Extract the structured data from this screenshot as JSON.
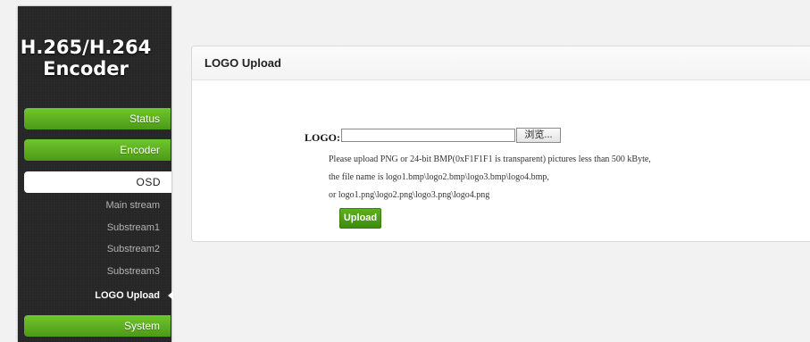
{
  "brand": {
    "line1": "H.265/H.264",
    "line2": "Encoder"
  },
  "sidebar": {
    "status_label": "Status",
    "encoder_label": "Encoder",
    "osd_label": "OSD",
    "sub_items": [
      {
        "label": "Main stream",
        "active": false
      },
      {
        "label": "Substream1",
        "active": false
      },
      {
        "label": "Substream2",
        "active": false
      },
      {
        "label": "Substream3",
        "active": false
      },
      {
        "label": "LOGO Upload",
        "active": true
      }
    ],
    "system_label": "System"
  },
  "panel": {
    "title": "LOGO Upload",
    "logo_label": "LOGO:",
    "file_value": "",
    "browse_label": "浏览...",
    "hint_lines": [
      "Please upload PNG or 24-bit BMP(0xF1F1F1 is transparent) pictures less than 500 kByte,",
      "the file name is logo1.bmp\\logo2.bmp\\logo3.bmp\\logo4.bmp,",
      "or logo1.png\\logo2.png\\logo3.png\\logo4.png"
    ],
    "upload_label": "Upload"
  },
  "colors": {
    "accent_green": "#5fb11d",
    "sidebar_bg": "#262626"
  }
}
